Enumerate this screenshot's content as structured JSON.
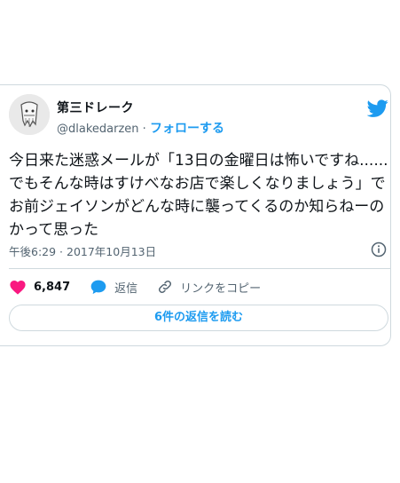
{
  "colors": {
    "accent": "#1d9bf0",
    "like": "#f91880",
    "text": "#0f1419",
    "muted": "#536471",
    "border": "#cfd9de"
  },
  "author": {
    "name": "第三ドレーク",
    "handle": "@dlakedarzen",
    "separator": "·",
    "follow_label": "フォローする"
  },
  "tweet": {
    "text": "今日来た迷惑メールが「13日の金曜日は怖いですね......でもそんな時はすけべなお店で楽しくなりましょう」でお前ジェイソンがどんな時に襲ってくるのか知らねーのかって思った",
    "timestamp": "午後6:29 · 2017年10月13日"
  },
  "actions": {
    "likes": "6,847",
    "reply_label": "返信",
    "copy_link_label": "リンクをコピー"
  },
  "read_replies_label": "6件の返信を読む",
  "icons": [
    "avatar-image",
    "twitter-bird-icon",
    "info-icon",
    "heart-icon",
    "reply-bubble-icon",
    "link-icon"
  ]
}
